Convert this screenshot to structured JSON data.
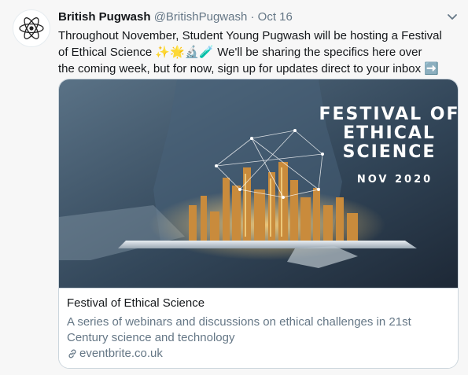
{
  "author": {
    "name": "British Pugwash",
    "handle": "@BritishPugwash",
    "separator": "·",
    "date": "Oct 16"
  },
  "tweet": {
    "line1": "Throughout November, Student Young Pugwash will be hosting a Festival",
    "line2_text": "of Ethical Science",
    "line2_emojis": "✨🌟🔬🧪",
    "line2_rest": " We'll be sharing the specifics here over",
    "line3": "the coming week, but for now, sign up for updates direct to your inbox",
    "arrow_emoji": "➡️"
  },
  "card": {
    "image": {
      "title_line1": "FESTIVAL OF",
      "title_line2": "ETHICAL",
      "title_line3": "SCIENCE",
      "date_text": "NOV 2020"
    },
    "title": "Festival of Ethical Science",
    "description": "A series of webinars and discussions on ethical challenges in 21st Century science and technology",
    "domain": "eventbrite.co.uk"
  },
  "icons": {
    "avatar": "atom-logo-icon",
    "menu": "chevron-down-icon",
    "link": "link-icon"
  },
  "colors": {
    "name_text": "#14171a",
    "secondary_text": "#657786",
    "card_border": "#ccd6dd",
    "background": "#f7f7f7"
  }
}
